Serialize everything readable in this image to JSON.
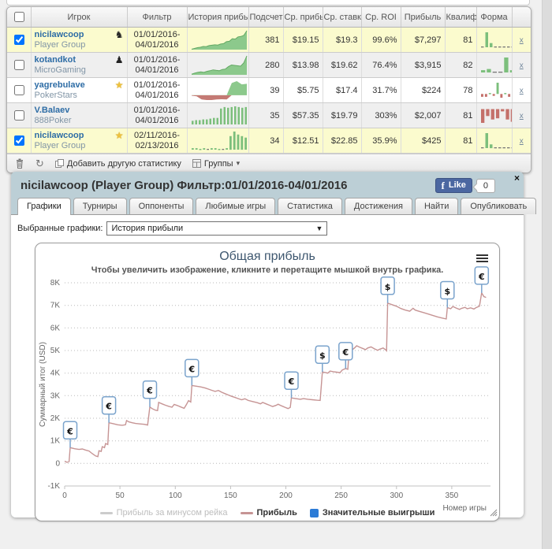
{
  "stats_table": {
    "headers": [
      "Игрок",
      "Фильтр",
      "История прибы",
      "Подсчет",
      "Ср. прибы",
      "Ср. ставк:",
      "Ср. ROI",
      "Прибыль",
      "Квалиф",
      "Форма"
    ],
    "rows": [
      {
        "checked": true,
        "highlight": "hl",
        "player": "nicilawcoop",
        "network": "Player Group",
        "badge_icon": "dark-figure-icon",
        "badge_glyph": "♞",
        "badge_style": "dark",
        "filter": "01/01/2016-04/01/2016",
        "count": "381",
        "avg_profit": "$19.15",
        "avg_stake": "$19.3",
        "avg_roi": "99.6%",
        "profit": "$7,297",
        "qualified": "81",
        "history": {
          "kind": "area",
          "values": [
            2,
            6,
            10,
            12,
            16,
            15,
            20,
            22,
            24,
            23,
            28,
            30,
            40,
            42,
            55,
            53,
            64,
            66,
            72,
            95
          ]
        },
        "form": [
          0,
          18,
          5,
          0,
          0,
          0,
          0,
          0
        ],
        "delete_label": "x"
      },
      {
        "checked": false,
        "highlight": "alt",
        "player": "kotandkot",
        "network": "MicroGaming",
        "badge_icon": "dark-figure-icon",
        "badge_glyph": "♟",
        "badge_style": "dark",
        "filter": "01/01/2016-04/01/2016",
        "count": "280",
        "avg_profit": "$13.98",
        "avg_stake": "$19.62",
        "avg_roi": "76.4%",
        "profit": "$3,915",
        "qualified": "82",
        "history": {
          "kind": "area",
          "values": [
            3,
            8,
            12,
            14,
            12,
            17,
            20,
            24,
            22,
            20,
            26,
            28,
            40,
            48,
            46,
            44,
            42,
            58,
            92
          ]
        },
        "form": [
          2,
          3,
          0,
          0,
          13,
          2
        ],
        "delete_label": "x"
      },
      {
        "checked": false,
        "highlight": "w",
        "player": "yagrebulave",
        "network": "PokerStars",
        "badge_icon": "star-badge-icon",
        "badge_glyph": "★",
        "badge_style": "star",
        "filter": "01/01/2016-04/01/2016",
        "count": "39",
        "avg_profit": "$5.75",
        "avg_stake": "$17.4",
        "avg_roi": "31.7%",
        "profit": "$224",
        "qualified": "78",
        "history": {
          "kind": "area",
          "values": [
            -2,
            -4,
            -16,
            -18,
            -18,
            -16,
            -15,
            -16,
            45,
            52,
            40,
            42
          ]
        },
        "form": [
          -3,
          -3,
          1,
          -2,
          12,
          -4,
          1,
          -3,
          -2
        ],
        "delete_label": "x"
      },
      {
        "checked": false,
        "highlight": "alt",
        "player": "V.Balaev",
        "network": "888Poker",
        "badge_icon": "",
        "badge_glyph": "",
        "badge_style": "",
        "filter": "01/01/2016-04/01/2016",
        "count": "35",
        "avg_profit": "$57.35",
        "avg_stake": "$19.79",
        "avg_roi": "303%",
        "profit": "$2,007",
        "qualified": "81",
        "history": {
          "kind": "bars",
          "values": [
            5,
            6,
            6,
            7,
            7,
            8,
            9,
            9,
            22,
            24,
            23,
            24,
            25,
            24,
            23,
            24
          ]
        },
        "form": [
          -12,
          -6,
          -9,
          -8,
          -2,
          -9,
          -11
        ],
        "delete_label": "x"
      },
      {
        "checked": true,
        "highlight": "hl",
        "player": "nicilawcoop",
        "network": "Player Group",
        "badge_icon": "star-badge-icon",
        "badge_glyph": "★",
        "badge_style": "star",
        "filter": "02/11/2016-02/13/2016",
        "count": "34",
        "avg_profit": "$12.51",
        "avg_stake": "$22.85",
        "avg_roi": "35.9%",
        "profit": "$425",
        "qualified": "81",
        "history": {
          "kind": "bars",
          "values": [
            2,
            2,
            1,
            2,
            0,
            2,
            2,
            1,
            0,
            2,
            18,
            24,
            20,
            18,
            16
          ]
        },
        "form": [
          0,
          16,
          4,
          0,
          0,
          0,
          0,
          0
        ],
        "delete_label": "x"
      }
    ],
    "toolbar": {
      "refresh_glyph": "↻",
      "add_label": "Добавить другую статистику",
      "groups_label": "Группы",
      "groups_caret": "▾"
    }
  },
  "panel": {
    "title": "nicilawcoop (Player Group) Фильтр:01/01/2016-04/01/2016",
    "close_glyph": "×",
    "fb": {
      "label": "Like",
      "f_glyph": "f",
      "count": "0"
    },
    "tabs": [
      {
        "label": "Графики",
        "active": true
      },
      {
        "label": "Турниры",
        "active": false
      },
      {
        "label": "Оппоненты",
        "active": false
      },
      {
        "label": "Любимые игры",
        "active": false
      },
      {
        "label": "Статистика",
        "active": false
      },
      {
        "label": "Достижения",
        "active": false
      },
      {
        "label": "Найти",
        "active": false
      },
      {
        "label": "Опубликовать",
        "active": false
      }
    ],
    "select_label": "Выбранные графики:",
    "select_value": "История прибыли",
    "select_caret": "▼"
  },
  "chart_data": {
    "type": "line",
    "title": "Общая прибыль",
    "subtitle": "Чтобы увеличить изображение, кликните и перетащите мышкой внутрь графика.",
    "ylabel": "Суммарный итог (USD)",
    "xlabel": "Номер игры",
    "xlim": [
      0,
      385
    ],
    "ylim": [
      -1000,
      8000
    ],
    "xticks": [
      0,
      50,
      100,
      150,
      200,
      250,
      300,
      350
    ],
    "yticks": [
      8000,
      7000,
      6000,
      5000,
      4000,
      3000,
      2000,
      1000,
      0,
      -1000
    ],
    "ytick_labels": [
      "8K",
      "7K",
      "6K",
      "5K",
      "4K",
      "3K",
      "2K",
      "1K",
      "0",
      "-1K"
    ],
    "grid": "horizontal-dotted",
    "legend_position": "bottom",
    "legend": [
      {
        "label": "Прибыль за минусом рейка",
        "color": "#cccccc",
        "swatch": "line",
        "disabled": true
      },
      {
        "label": "Прибыль",
        "color": "#c69494",
        "swatch": "line",
        "disabled": false
      },
      {
        "label": "Значительные выигрыши",
        "color": "#2b7bd6",
        "swatch": "square",
        "disabled": false
      }
    ],
    "series": [
      {
        "name": "Прибыль",
        "color": "#c69494",
        "points": [
          [
            0,
            100
          ],
          [
            2,
            50
          ],
          [
            4,
            80
          ],
          [
            5,
            700
          ],
          [
            9,
            650
          ],
          [
            13,
            620
          ],
          [
            16,
            640
          ],
          [
            19,
            590
          ],
          [
            22,
            550
          ],
          [
            25,
            430
          ],
          [
            28,
            330
          ],
          [
            30,
            300
          ],
          [
            31,
            560
          ],
          [
            33,
            530
          ],
          [
            34,
            740
          ],
          [
            36,
            700
          ],
          [
            37,
            880
          ],
          [
            39,
            840
          ],
          [
            40,
            1800
          ],
          [
            44,
            1760
          ],
          [
            48,
            1710
          ],
          [
            52,
            1690
          ],
          [
            55,
            1710
          ],
          [
            56,
            1900
          ],
          [
            58,
            1840
          ],
          [
            61,
            1800
          ],
          [
            64,
            1770
          ],
          [
            68,
            1750
          ],
          [
            72,
            1730
          ],
          [
            75,
            1700
          ],
          [
            77,
            2500
          ],
          [
            79,
            2430
          ],
          [
            82,
            2360
          ],
          [
            84,
            2340
          ],
          [
            85,
            2700
          ],
          [
            88,
            2640
          ],
          [
            91,
            2580
          ],
          [
            94,
            2530
          ],
          [
            97,
            2490
          ],
          [
            99,
            2610
          ],
          [
            102,
            2560
          ],
          [
            105,
            2500
          ],
          [
            108,
            2440
          ],
          [
            110,
            2600
          ],
          [
            112,
            2780
          ],
          [
            114,
            2720
          ],
          [
            115,
            3450
          ],
          [
            119,
            3420
          ],
          [
            123,
            3390
          ],
          [
            127,
            3340
          ],
          [
            130,
            3290
          ],
          [
            133,
            3240
          ],
          [
            136,
            3190
          ],
          [
            139,
            3230
          ],
          [
            142,
            3150
          ],
          [
            145,
            3090
          ],
          [
            148,
            3030
          ],
          [
            151,
            2970
          ],
          [
            154,
            2920
          ],
          [
            157,
            2870
          ],
          [
            160,
            2820
          ],
          [
            163,
            2860
          ],
          [
            166,
            2790
          ],
          [
            170,
            2740
          ],
          [
            174,
            2690
          ],
          [
            177,
            2640
          ],
          [
            179,
            2700
          ],
          [
            182,
            2640
          ],
          [
            185,
            2580
          ],
          [
            188,
            2520
          ],
          [
            191,
            2570
          ],
          [
            193,
            2620
          ],
          [
            196,
            2550
          ],
          [
            199,
            2490
          ],
          [
            202,
            2430
          ],
          [
            204,
            2480
          ],
          [
            205,
            2900
          ],
          [
            209,
            2870
          ],
          [
            213,
            2840
          ],
          [
            216,
            2870
          ],
          [
            220,
            2840
          ],
          [
            224,
            2820
          ],
          [
            228,
            2800
          ],
          [
            231,
            2790
          ],
          [
            233,
            4050
          ],
          [
            236,
            4020
          ],
          [
            238,
            4000
          ],
          [
            240,
            4090
          ],
          [
            243,
            4060
          ],
          [
            246,
            4040
          ],
          [
            249,
            4020
          ],
          [
            251,
            4140
          ],
          [
            254,
            4200
          ],
          [
            256,
            4170
          ],
          [
            257,
            4880
          ],
          [
            259,
            4990
          ],
          [
            262,
            5110
          ],
          [
            264,
            5210
          ],
          [
            267,
            5140
          ],
          [
            270,
            5080
          ],
          [
            272,
            5040
          ],
          [
            274,
            5110
          ],
          [
            277,
            5160
          ],
          [
            280,
            5080
          ],
          [
            283,
            5010
          ],
          [
            285,
            5060
          ],
          [
            288,
            5110
          ],
          [
            290,
            5040
          ],
          [
            291,
            4990
          ],
          [
            292,
            7100
          ],
          [
            296,
            7030
          ],
          [
            300,
            6960
          ],
          [
            304,
            6860
          ],
          [
            308,
            6790
          ],
          [
            312,
            6740
          ],
          [
            315,
            6870
          ],
          [
            317,
            6790
          ],
          [
            321,
            6730
          ],
          [
            325,
            6670
          ],
          [
            329,
            6610
          ],
          [
            333,
            6550
          ],
          [
            337,
            6490
          ],
          [
            341,
            6440
          ],
          [
            345,
            6400
          ],
          [
            346,
            6900
          ],
          [
            349,
            6850
          ],
          [
            351,
            6950
          ],
          [
            354,
            6880
          ],
          [
            357,
            6820
          ],
          [
            359,
            6870
          ],
          [
            362,
            6910
          ],
          [
            364,
            6850
          ],
          [
            367,
            6890
          ],
          [
            370,
            6840
          ],
          [
            372,
            6900
          ],
          [
            375,
            6960
          ],
          [
            377,
            7550
          ],
          [
            379,
            7390
          ],
          [
            381,
            7350
          ]
        ]
      }
    ],
    "markers": [
      {
        "x": 5,
        "y": 700,
        "symbol": "€"
      },
      {
        "x": 40,
        "y": 1800,
        "symbol": "€"
      },
      {
        "x": 77,
        "y": 2500,
        "symbol": "€"
      },
      {
        "x": 115,
        "y": 3450,
        "symbol": "€"
      },
      {
        "x": 205,
        "y": 2900,
        "symbol": "€"
      },
      {
        "x": 233,
        "y": 4050,
        "symbol": "$"
      },
      {
        "x": 254,
        "y": 4200,
        "symbol": "€"
      },
      {
        "x": 292,
        "y": 7100,
        "symbol": "$"
      },
      {
        "x": 346,
        "y": 6900,
        "symbol": "$"
      },
      {
        "x": 377,
        "y": 7550,
        "symbol": "€"
      }
    ]
  }
}
